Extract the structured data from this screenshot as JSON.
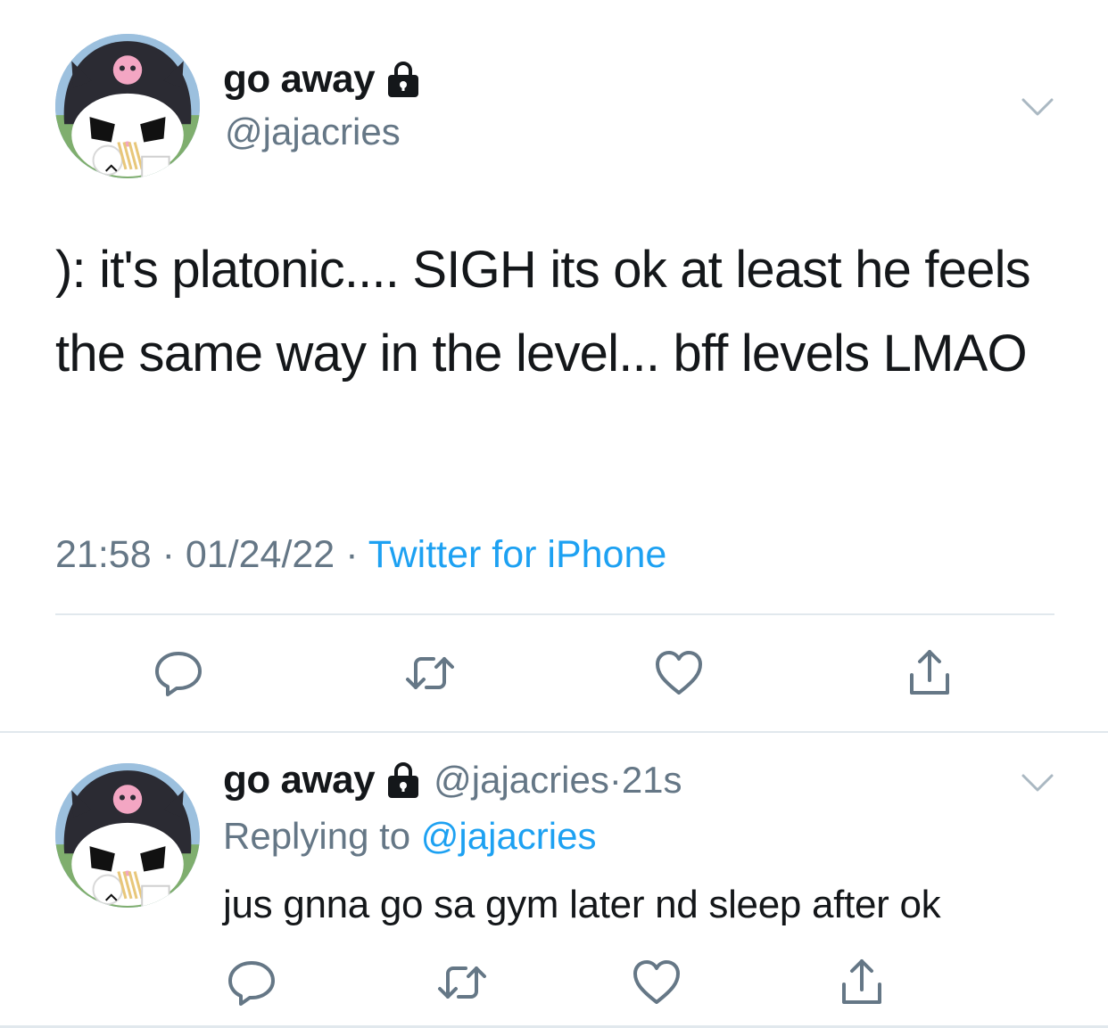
{
  "tweet": {
    "author_name": "go away",
    "author_handle": "@jajacries",
    "text": "): it's platonic.... SIGH its ok at least he feels the same way in the level... bff levels LMAO",
    "time": "21:58",
    "separator": "·",
    "date": "01/24/22",
    "source": "Twitter for iPhone",
    "protected_icon": "lock-icon",
    "menu_icon": "chevron-down-icon",
    "actions": [
      {
        "name": "reply",
        "icon": "reply-icon"
      },
      {
        "name": "retweet",
        "icon": "retweet-icon"
      },
      {
        "name": "like",
        "icon": "heart-icon"
      },
      {
        "name": "share",
        "icon": "share-icon"
      }
    ]
  },
  "reply": {
    "author_name": "go away",
    "author_handle": "@jajacries",
    "separator": "·",
    "time_ago": "21s",
    "replying_prefix": "Replying to",
    "replying_to": "@jajacries",
    "text": "jus gnna go sa gym later nd sleep after ok",
    "protected_icon": "lock-icon",
    "menu_icon": "chevron-down-icon"
  },
  "colors": {
    "text_primary": "#14171a",
    "text_secondary": "#657786",
    "link_blue": "#1da1f2",
    "divider": "#e1e8ed",
    "icon_gray": "#657786"
  }
}
